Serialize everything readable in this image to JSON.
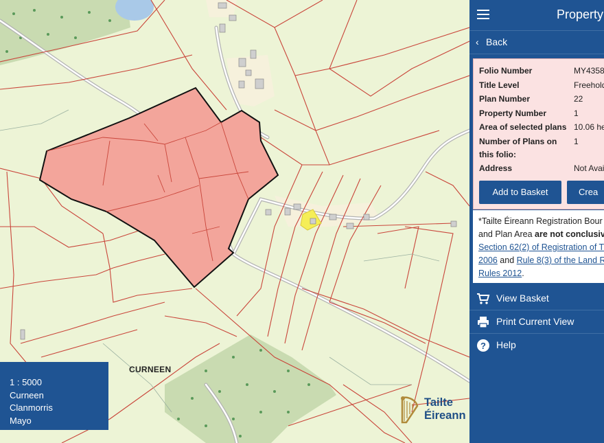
{
  "map": {
    "townland_label": "CURNEEN",
    "scale_box": {
      "scale": "1 : 5000",
      "townland": "Curneen",
      "area": "Clanmorris",
      "county": "Mayo"
    },
    "logo": {
      "line1": "Tailte",
      "line2": "Éireann"
    },
    "colors": {
      "fields": "#edf4d6",
      "boundary_red": "#c43a2f",
      "selected_parcel": "#f2a39a",
      "forest": "#c8dbb0",
      "building_yard": "#f6f1dc",
      "highlight_yellow": "#f5ee57"
    }
  },
  "panel": {
    "title": "Property",
    "back_label": "Back",
    "info": {
      "rows": [
        {
          "label": "Folio Number",
          "value": "MY4358"
        },
        {
          "label": "Title Level",
          "value": "Freehold"
        },
        {
          "label": "Plan Number",
          "value": "22"
        },
        {
          "label": "Property Number",
          "value": "1"
        },
        {
          "label": "Area of selected plans",
          "value": "10.06 he"
        },
        {
          "label": "Number of Plans on this folio:",
          "value": "1"
        },
        {
          "label": "Address",
          "value": "Not Avai"
        }
      ],
      "add_to_basket": "Add to Basket",
      "create": "Crea"
    },
    "disclaimer": {
      "line1": "*Tailte Éireann Registration Bour",
      "line2_start": "and Plan Area ",
      "line2_bold": "are not conclusive",
      "link1": "Section 62(2) of Registration of T",
      "year": "2006",
      "and": " and ",
      "link2": "Rule 8(3) of the Land R",
      "link3": "Rules 2012",
      "end": "."
    },
    "menu": [
      {
        "label": "View Basket",
        "icon": "cart-icon"
      },
      {
        "label": "Print Current View",
        "icon": "printer-icon"
      },
      {
        "label": "Help",
        "icon": "help-icon"
      }
    ]
  }
}
